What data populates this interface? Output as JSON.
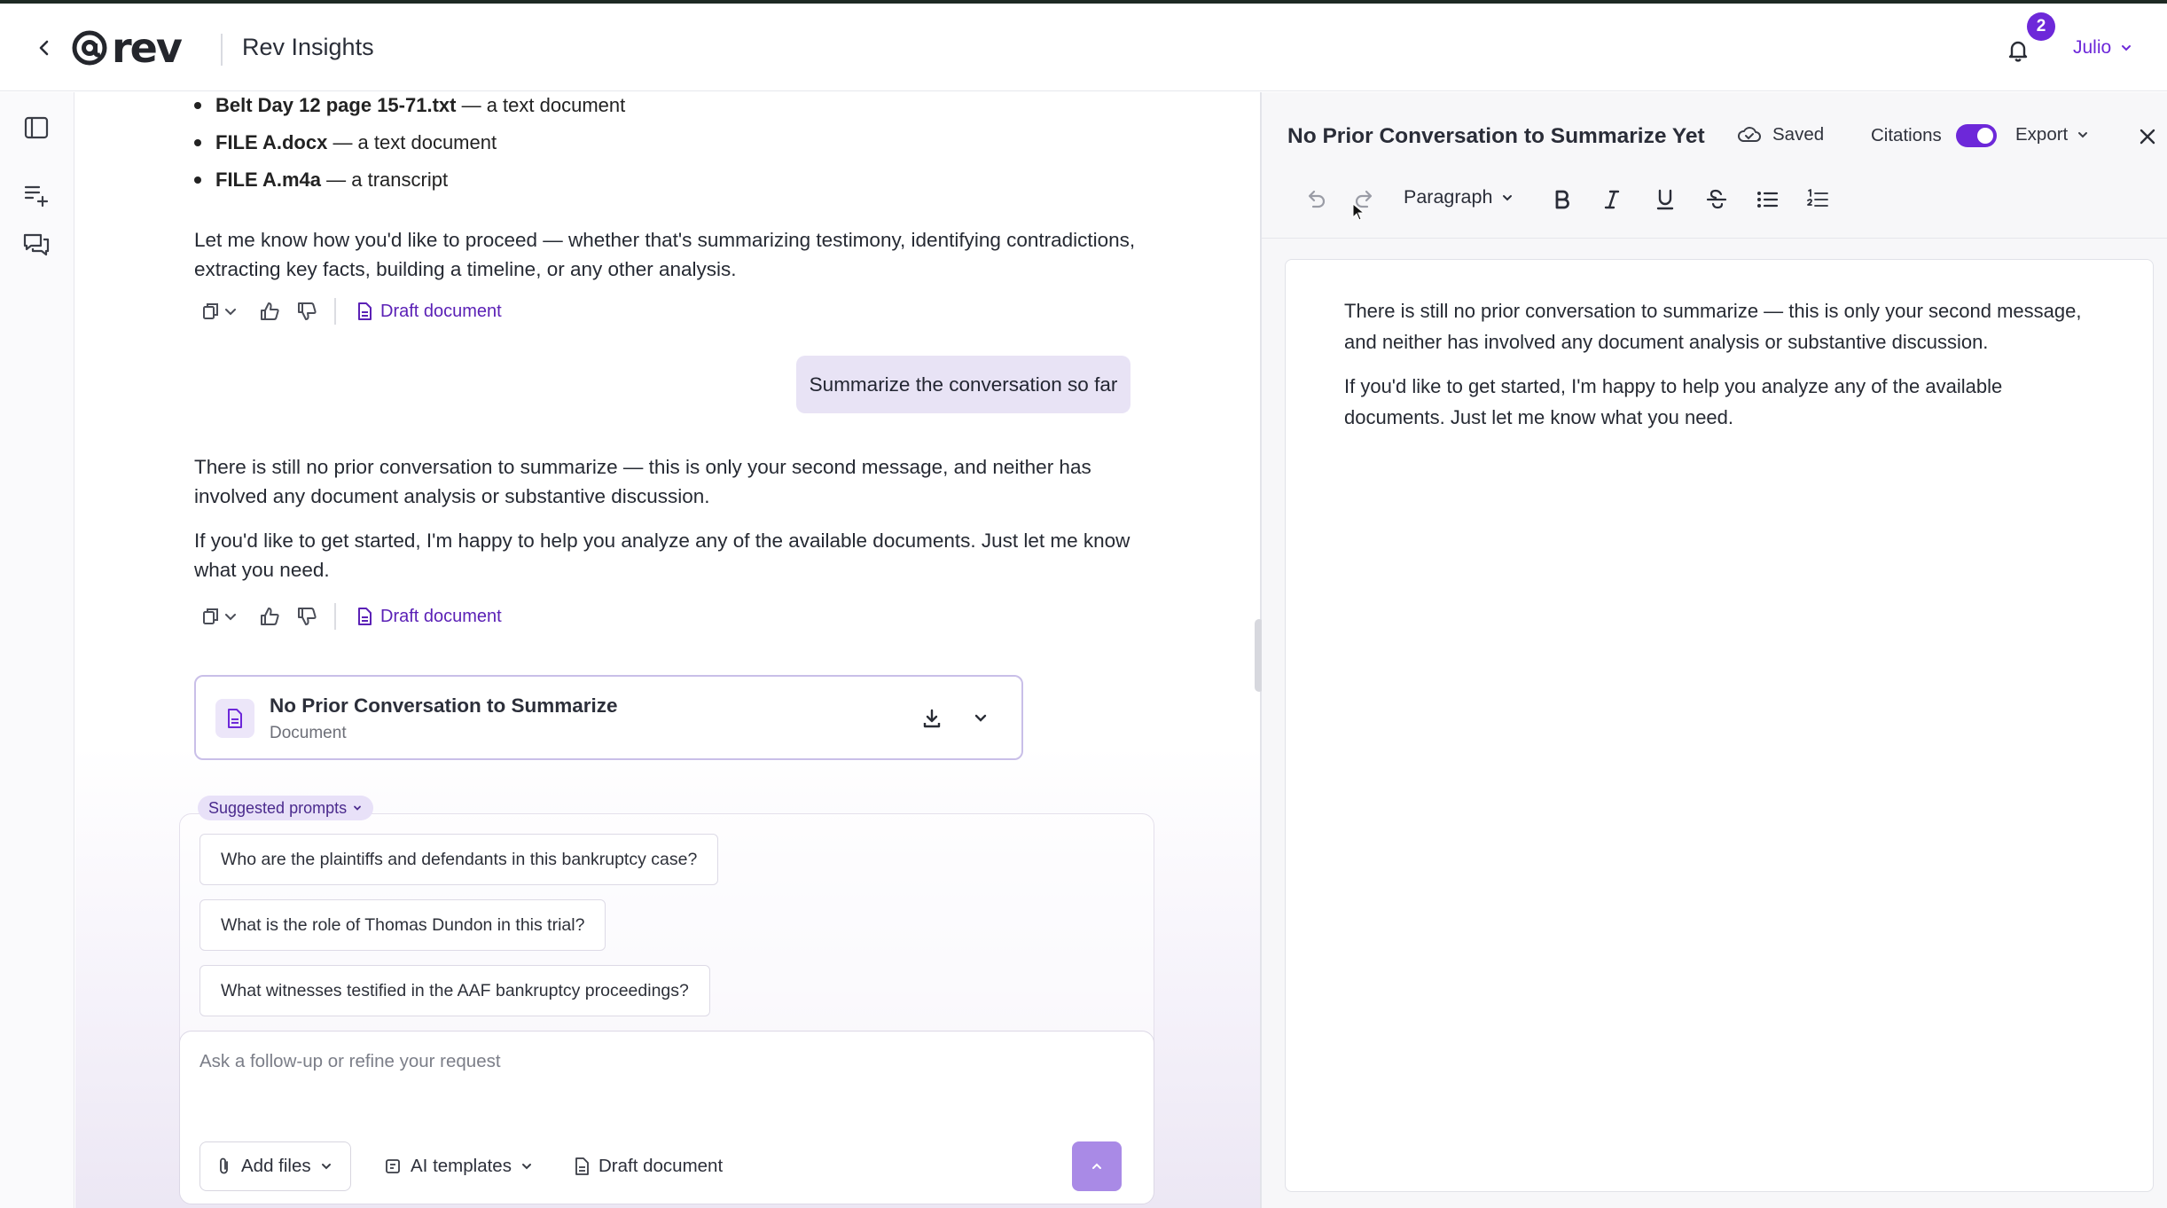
{
  "header": {
    "logo_text": "rev",
    "app_title": "Rev Insights",
    "notification_count": "2",
    "user_name": "Julio"
  },
  "chat": {
    "files": [
      {
        "name": "Belt Day 12 page 15-71.txt",
        "desc": "— a text document"
      },
      {
        "name": "FILE A.docx",
        "desc": "— a text document"
      },
      {
        "name": "FILE A.m4a",
        "desc": "— a transcript"
      }
    ],
    "proceed_text": "Let me know how you'd like to proceed — whether that's summarizing testimony, identifying contradictions, extracting key facts, building a timeline, or any other analysis.",
    "draft_document_label": "Draft document",
    "user_message": "Summarize the conversation so far",
    "reply_paragraph_1": "There is still no prior conversation to summarize — this is only your second message, and neither has involved any document analysis or substantive discussion.",
    "reply_paragraph_2": "If you'd like to get started, I'm happy to help you analyze any of the available documents. Just let me know what you need.",
    "doc_card": {
      "title": "No Prior Conversation to Summarize",
      "subtitle": "Document"
    },
    "suggested_prompts_label": "Suggested prompts",
    "prompts": [
      "Who are the plaintiffs and defendants in this bankruptcy case?",
      "What is the role of Thomas Dundon in this trial?",
      "What witnesses testified in the AAF bankruptcy proceedings?"
    ],
    "composer": {
      "placeholder": "Ask a follow-up or refine your request",
      "add_files": "Add files",
      "ai_templates": "AI templates",
      "draft_document": "Draft document"
    }
  },
  "editor": {
    "title": "No Prior Conversation to Summarize Yet",
    "saved_label": "Saved",
    "citations_label": "Citations",
    "citations_on": true,
    "export_label": "Export",
    "block_style": "Paragraph",
    "paragraphs": [
      "There is still no prior conversation to summarize — this is only your second message, and neither has involved any document analysis or substantive discussion.",
      "If you'd like to get started, I'm happy to help you analyze any of the available documents. Just let me know what you need."
    ]
  },
  "colors": {
    "accent": "#6d28d9",
    "user_bubble": "#e8e3f5",
    "send_button": "#a98ae6"
  }
}
